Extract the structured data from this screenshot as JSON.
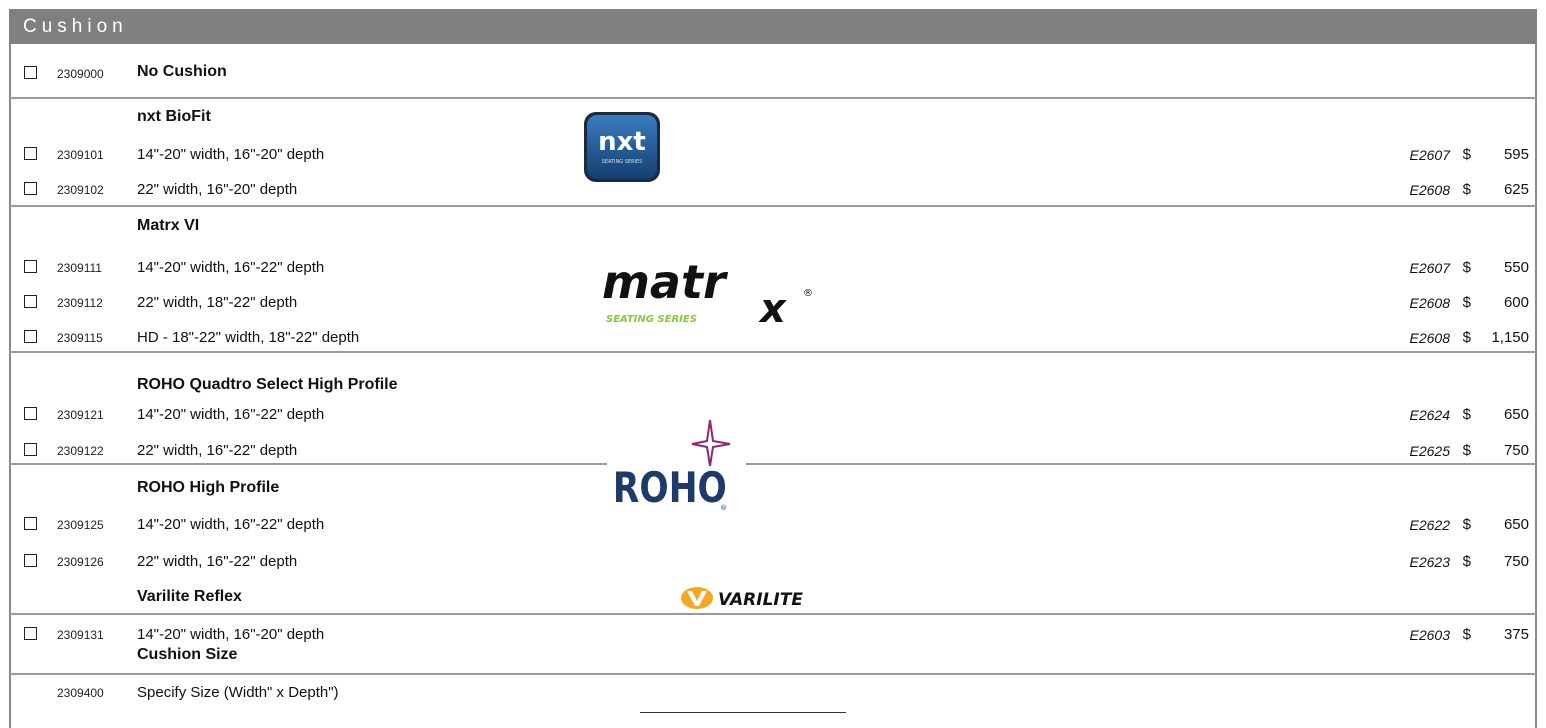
{
  "section_title": "Cushion",
  "no_cushion": {
    "code": "2309000",
    "label": "No Cushion"
  },
  "groups": [
    {
      "title": "nxt BioFit",
      "logo": "nxt-logo",
      "logo_text": "nxt",
      "logo_sub": "SEATING SERIES",
      "items": [
        {
          "code": "2309101",
          "desc": "14\"-20\" width, 16\"-20\" depth",
          "hcpcs": "E2607",
          "currency": "$",
          "price": "595"
        },
        {
          "code": "2309102",
          "desc": "22\" width, 16\"-20\" depth",
          "hcpcs": "E2608",
          "currency": "$",
          "price": "625"
        }
      ]
    },
    {
      "title": "Matrx VI",
      "logo": "matrx-logo",
      "logo_text": "matr",
      "logo_x": "x",
      "logo_reg": "®",
      "logo_sub": "SEATING SERIES",
      "items": [
        {
          "code": "2309111",
          "desc": "14\"-20\" width, 16\"-22\" depth",
          "hcpcs": "E2607",
          "currency": "$",
          "price": "550"
        },
        {
          "code": "2309112",
          "desc": "22\" width, 18\"-22\" depth",
          "hcpcs": "E2608",
          "currency": "$",
          "price": "600"
        },
        {
          "code": "2309115",
          "desc": "HD - 18\"-22\" width, 18\"-22\" depth",
          "hcpcs": "E2608",
          "currency": "$",
          "price": "1,150"
        }
      ]
    },
    {
      "title": "ROHO Quadtro Select High Profile",
      "logo": "roho-logo",
      "logo_text": "ROHO",
      "logo_reg": "®",
      "items": [
        {
          "code": "2309121",
          "desc": "14\"-20\" width, 16\"-22\" depth",
          "hcpcs": "E2624",
          "currency": "$",
          "price": "650"
        },
        {
          "code": "2309122",
          "desc": "22\" width, 16\"-22\" depth",
          "hcpcs": "E2625",
          "currency": "$",
          "price": "750"
        }
      ]
    },
    {
      "title": "ROHO High Profile",
      "items": [
        {
          "code": "2309125",
          "desc": "14\"-20\" width, 16\"-22\" depth",
          "hcpcs": "E2622",
          "currency": "$",
          "price": "650"
        },
        {
          "code": "2309126",
          "desc": "22\" width, 16\"-22\" depth",
          "hcpcs": "E2623",
          "currency": "$",
          "price": "750"
        }
      ]
    },
    {
      "title": "Varilite Reflex",
      "logo": "varilite-logo",
      "logo_text": "VARILITE",
      "items": [
        {
          "code": "2309131",
          "desc": "14\"-20\" width, 16\"-20\" depth",
          "hcpcs": "E2603",
          "currency": "$",
          "price": "375"
        }
      ]
    },
    {
      "title": "Cushion Size",
      "items": [
        {
          "code": "2309400",
          "desc": "Specify Size (Width\" x Depth\")"
        }
      ]
    }
  ],
  "colors": {
    "header_bg": "#808080",
    "nxt_blue": "#1f5fa0",
    "matrx_green": "#8cc63f",
    "roho_blue": "#1d3a6b",
    "roho_star": "#8b2b6e",
    "varilite_orange": "#f5a623"
  }
}
